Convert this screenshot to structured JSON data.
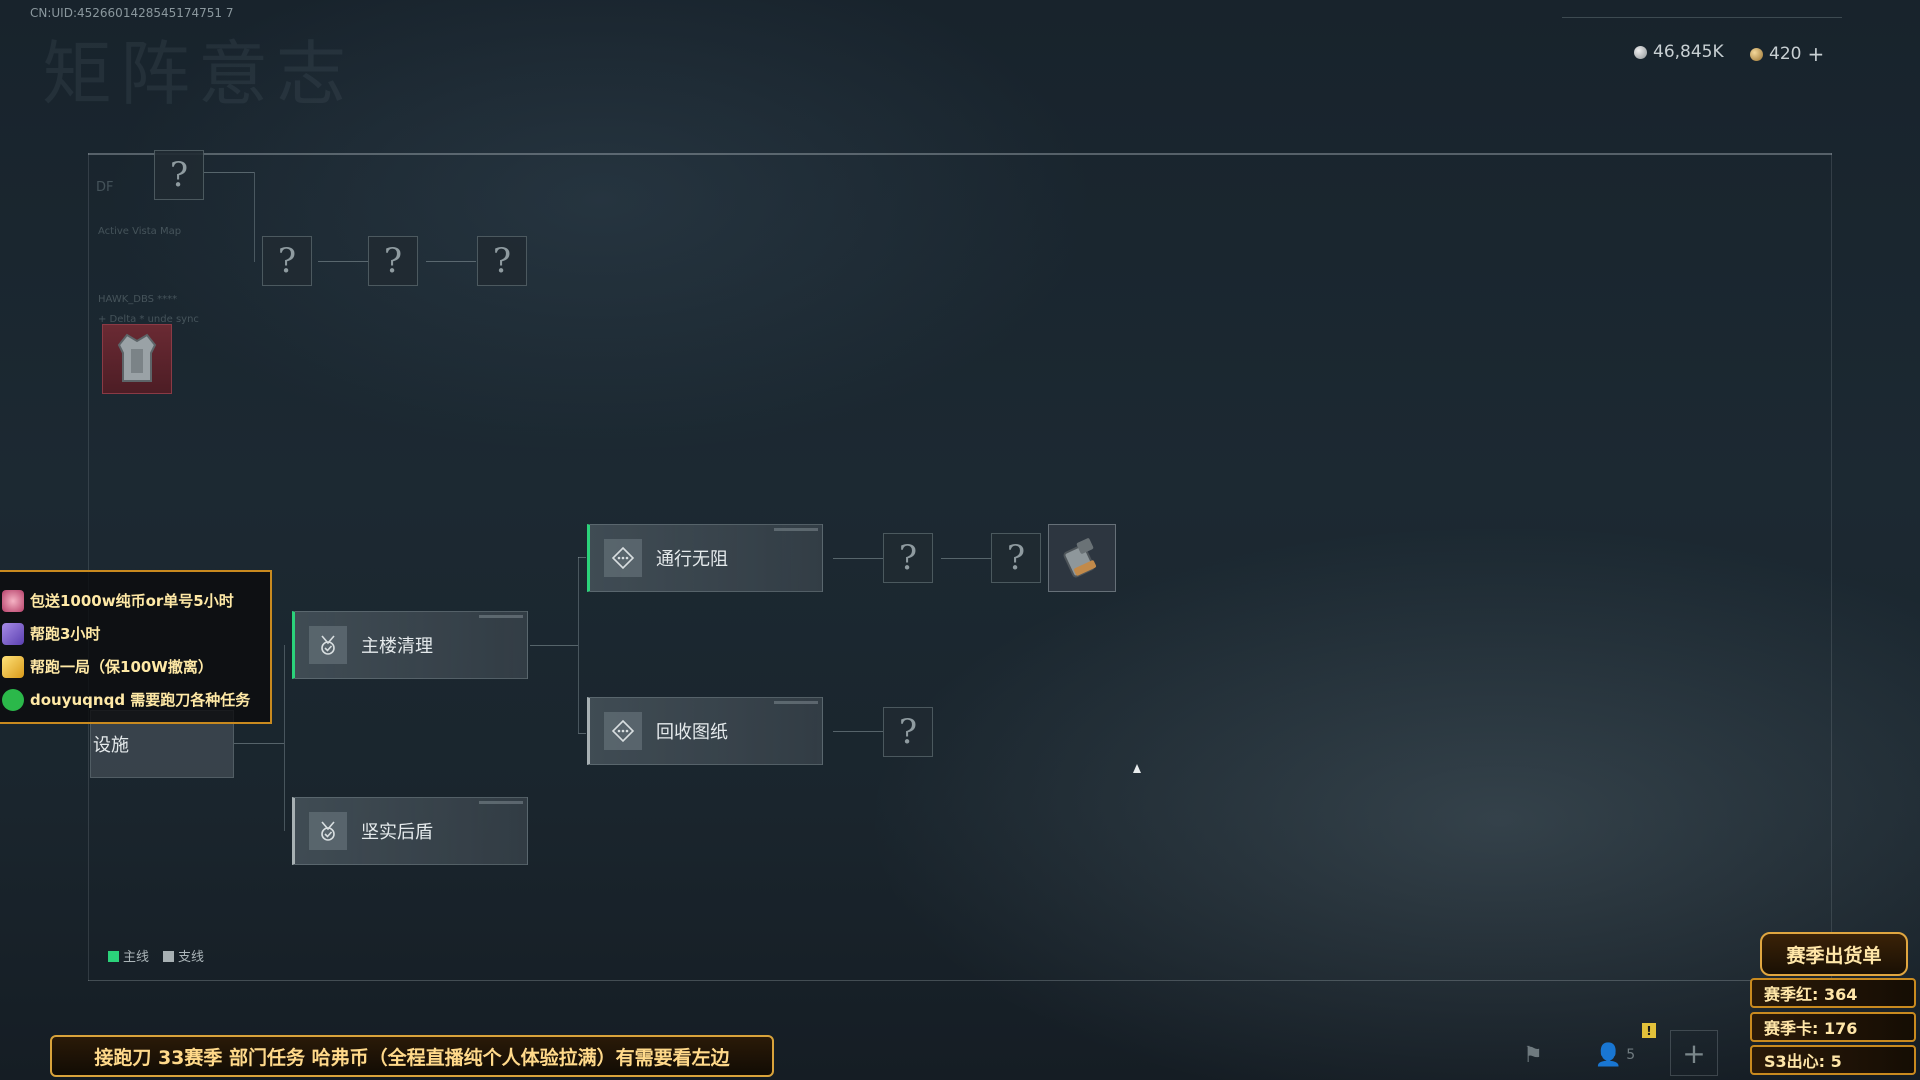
{
  "header": {
    "uid": "CN:UID:4526601428545174751 7",
    "watermark_title": "矩阵意志",
    "currency_silver": "46,845K",
    "currency_gold": "420",
    "gold_plus": "+"
  },
  "map": {
    "unknown_mark": "?",
    "partial_node_label": "设施",
    "deco": [
      "DF",
      "Active Vista Map",
      "HAWK_DBS ****",
      "+ Delta * unde sync"
    ]
  },
  "nodes": {
    "main_building": "主楼清理",
    "solid_shield": "坚实后盾",
    "pass_through": "通行无阻",
    "recover_blueprint": "回收图纸"
  },
  "legend": {
    "main": "主线",
    "side": "支线",
    "main_color": "#2bd27a",
    "side_color": "#a7b0b3"
  },
  "overlay": {
    "items": [
      "包送1000w纯币or单号5小时",
      "帮跑3小时",
      "帮跑一局（保100W撤离）",
      "douyuqnqd 需要跑刀各种任务"
    ]
  },
  "banner": {
    "text": "接跑刀 33赛季 部门任务 哈弗币（全程直播纯个人体验拉满）有需要看左边"
  },
  "season": {
    "title": "赛季出货单",
    "red": "赛季红: 364",
    "card": "赛季卡: 176",
    "heart": "S3出心: 5"
  },
  "hud": {
    "players": "5",
    "plus": "+",
    "warn": "!"
  }
}
